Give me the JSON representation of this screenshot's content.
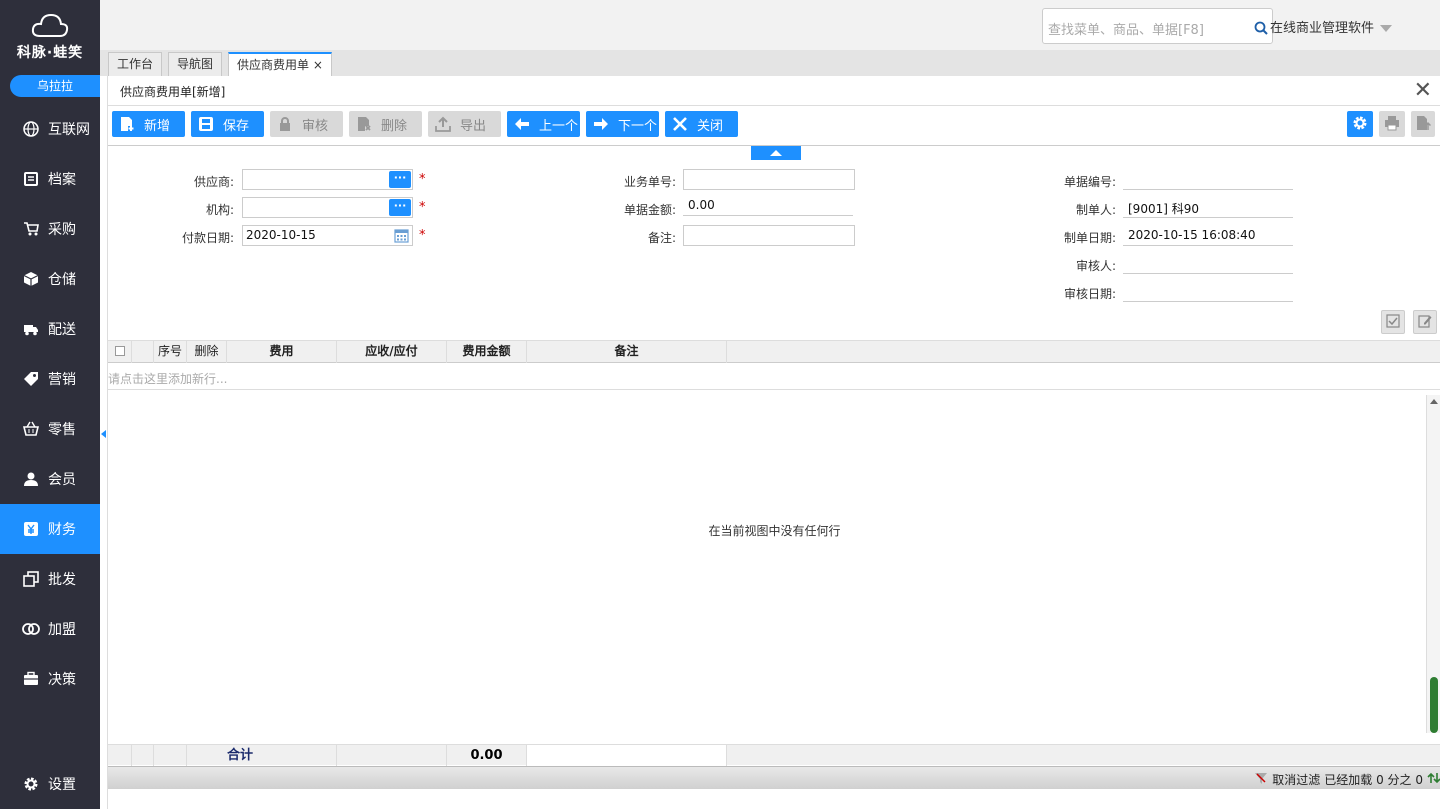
{
  "brand": {
    "name": "科脉·蛙笑",
    "user": "乌拉拉"
  },
  "nav": [
    {
      "label": "互联网",
      "icon": "globe-icon"
    },
    {
      "label": "档案",
      "icon": "file-icon"
    },
    {
      "label": "采购",
      "icon": "cart-icon"
    },
    {
      "label": "仓储",
      "icon": "box-icon"
    },
    {
      "label": "配送",
      "icon": "truck-icon"
    },
    {
      "label": "营销",
      "icon": "tag-icon"
    },
    {
      "label": "零售",
      "icon": "basket-icon"
    },
    {
      "label": "会员",
      "icon": "user-icon"
    },
    {
      "label": "财务",
      "icon": "yen-icon",
      "active": true
    },
    {
      "label": "批发",
      "icon": "copy-icon"
    },
    {
      "label": "加盟",
      "icon": "rings-icon"
    },
    {
      "label": "决策",
      "icon": "briefcase-icon"
    },
    {
      "label": "设置",
      "icon": "gear-icon"
    }
  ],
  "topbar": {
    "search_placeholder": "查找菜单、商品、单据[F8]",
    "app_name": "在线商业管理软件"
  },
  "tabs": [
    {
      "label": "工作台"
    },
    {
      "label": "导航图"
    },
    {
      "label": "供应商费用单",
      "close": "×"
    }
  ],
  "panel": {
    "title": "供应商费用单[新增]",
    "close": "✕"
  },
  "toolbar": {
    "new": "新增",
    "save": "保存",
    "audit": "审核",
    "delete": "删除",
    "export": "导出",
    "prev": "上一个",
    "next": "下一个",
    "close": "关闭"
  },
  "form": {
    "supplier_label": "供应商:",
    "supplier_value": "",
    "org_label": "机构:",
    "org_value": "",
    "pay_date_label": "付款日期:",
    "pay_date_value": "2020-10-15",
    "biz_no_label": "业务单号:",
    "biz_no_value": "",
    "amount_label": "单据金额:",
    "amount_value": "0.00",
    "remark_label": "备注:",
    "remark_value": "",
    "doc_no_label": "单据编号:",
    "doc_no_value": "",
    "creator_label": "制单人:",
    "creator_value": "[9001] 科90",
    "create_date_label": "制单日期:",
    "create_date_value": "2020-10-15 16:08:40",
    "auditor_label": "审核人:",
    "auditor_value": "",
    "audit_date_label": "审核日期:",
    "audit_date_value": "",
    "required_mark": "*",
    "more_dots": "···"
  },
  "grid": {
    "columns": [
      "序号",
      "删除",
      "费用",
      "应收/应付",
      "费用金额",
      "备注"
    ],
    "add_row_hint": "请点击这里添加新行...",
    "empty_message": "在当前视图中没有任何行",
    "footer_label": "合计",
    "footer_amount": "0.00"
  },
  "status": {
    "cancel_filter": "取消过滤",
    "loaded": "已经加载 0 分之 0"
  },
  "colors": {
    "accent": "#1e90ff",
    "sidebar": "#2e2f3b"
  }
}
